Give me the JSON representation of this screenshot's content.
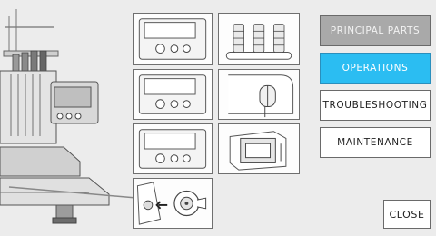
{
  "menu": {
    "principal_parts": "PRINCIPAL PARTS",
    "operations": "OPERATIONS",
    "troubleshooting": "TROUBLESHOOTING",
    "maintenance": "MAINTENANCE"
  },
  "close_label": "CLOSE",
  "colors": {
    "background": "#ececec",
    "selected": "#2bbdf2",
    "disabled": "#a9a9a9"
  },
  "tiles": [
    {
      "name": "operation-panel-tile-1",
      "icon": "operation-panel-icon"
    },
    {
      "name": "thread-spools-tile",
      "icon": "thread-spools-icon"
    },
    {
      "name": "operation-panel-tile-2",
      "icon": "operation-panel-icon"
    },
    {
      "name": "needle-bar-cover-tile",
      "icon": "machine-head-icon"
    },
    {
      "name": "operation-panel-tile-3",
      "icon": "operation-panel-icon"
    },
    {
      "name": "card-slot-tile",
      "icon": "card-slot-icon"
    },
    {
      "name": "bobbin-case-tile",
      "icon": "bobbin-case-icon"
    }
  ]
}
